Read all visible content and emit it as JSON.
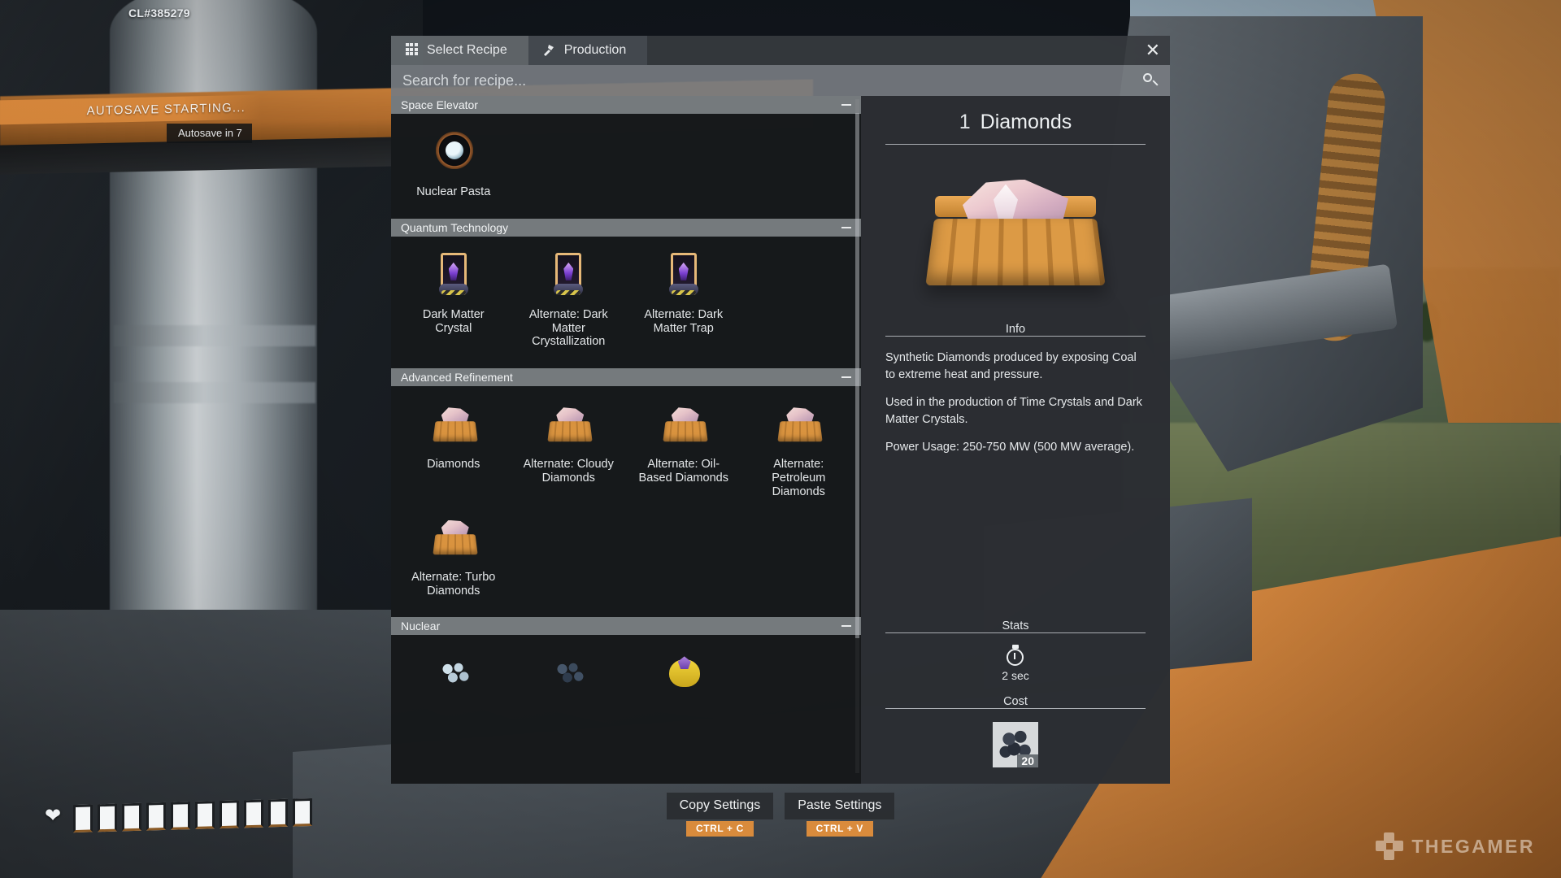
{
  "hud": {
    "changelist": "CL#385279",
    "autosave_banner": "AUTOSAVE STARTING...",
    "autosave_chip": "Autosave in 7",
    "health_icon": "heart-pulse-icon",
    "watermark": "THEGAMER"
  },
  "dialog": {
    "tabs": [
      {
        "label": "Select Recipe",
        "icon": "grid-icon",
        "active": true
      },
      {
        "label": "Production",
        "icon": "hammer-icon",
        "active": false
      }
    ],
    "close_label": "✕",
    "search": {
      "value": "",
      "placeholder": "Search for recipe...",
      "icon": "search-icon"
    },
    "sections": [
      {
        "title": "Space Elevator",
        "collapse_icon": "minus-icon",
        "recipes": [
          {
            "label": "Nuclear Pasta",
            "icon": "nuclear-pasta-icon"
          }
        ]
      },
      {
        "title": "Quantum Technology",
        "collapse_icon": "minus-icon",
        "recipes": [
          {
            "label": "Dark Matter Crystal",
            "icon": "dark-matter-crystal-icon"
          },
          {
            "label": "Alternate: Dark Matter Crystallization",
            "icon": "dark-matter-crystal-icon"
          },
          {
            "label": "Alternate: Dark Matter Trap",
            "icon": "dark-matter-crystal-icon"
          }
        ]
      },
      {
        "title": "Advanced Refinement",
        "collapse_icon": "minus-icon",
        "recipes": [
          {
            "label": "Diamonds",
            "icon": "diamonds-crate-icon"
          },
          {
            "label": "Alternate: Cloudy Diamonds",
            "icon": "diamonds-crate-icon"
          },
          {
            "label": "Alternate: Oil-Based Diamonds",
            "icon": "diamonds-crate-icon"
          },
          {
            "label": "Alternate: Petroleum Diamonds",
            "icon": "diamonds-crate-icon"
          },
          {
            "label": "Alternate: Turbo Diamonds",
            "icon": "diamonds-crate-icon"
          }
        ]
      },
      {
        "title": "Nuclear",
        "collapse_icon": "minus-icon",
        "recipes": [
          {
            "label": "",
            "icon": "uranium-icon"
          },
          {
            "label": "",
            "icon": "plutonium-icon"
          },
          {
            "label": "",
            "icon": "ficsonium-icon"
          }
        ]
      }
    ],
    "detail": {
      "amount": "1",
      "name": "Diamonds",
      "preview_icon": "diamonds-crate-large-icon",
      "info_heading": "Info",
      "info_paragraphs": [
        "Synthetic Diamonds produced by exposing Coal to extreme heat and pressure.",
        "Used in the production of Time Crystals and Dark Matter Crystals.",
        "Power Usage: 250-750 MW (500 MW average)."
      ],
      "stats_heading": "Stats",
      "craft_time_icon": "stopwatch-icon",
      "craft_time": "2 sec",
      "cost_heading": "Cost",
      "cost_items": [
        {
          "icon": "coal-icon",
          "quantity": "20"
        }
      ]
    }
  },
  "footer": {
    "buttons": [
      {
        "label": "Copy Settings",
        "shortcut": "CTRL + C"
      },
      {
        "label": "Paste Settings",
        "shortcut": "CTRL + V"
      }
    ]
  },
  "colors": {
    "accent_orange": "#d98b3c",
    "panel_bg": "#2d3034",
    "list_bg": "#16181a",
    "section_header": "#7e8286"
  }
}
